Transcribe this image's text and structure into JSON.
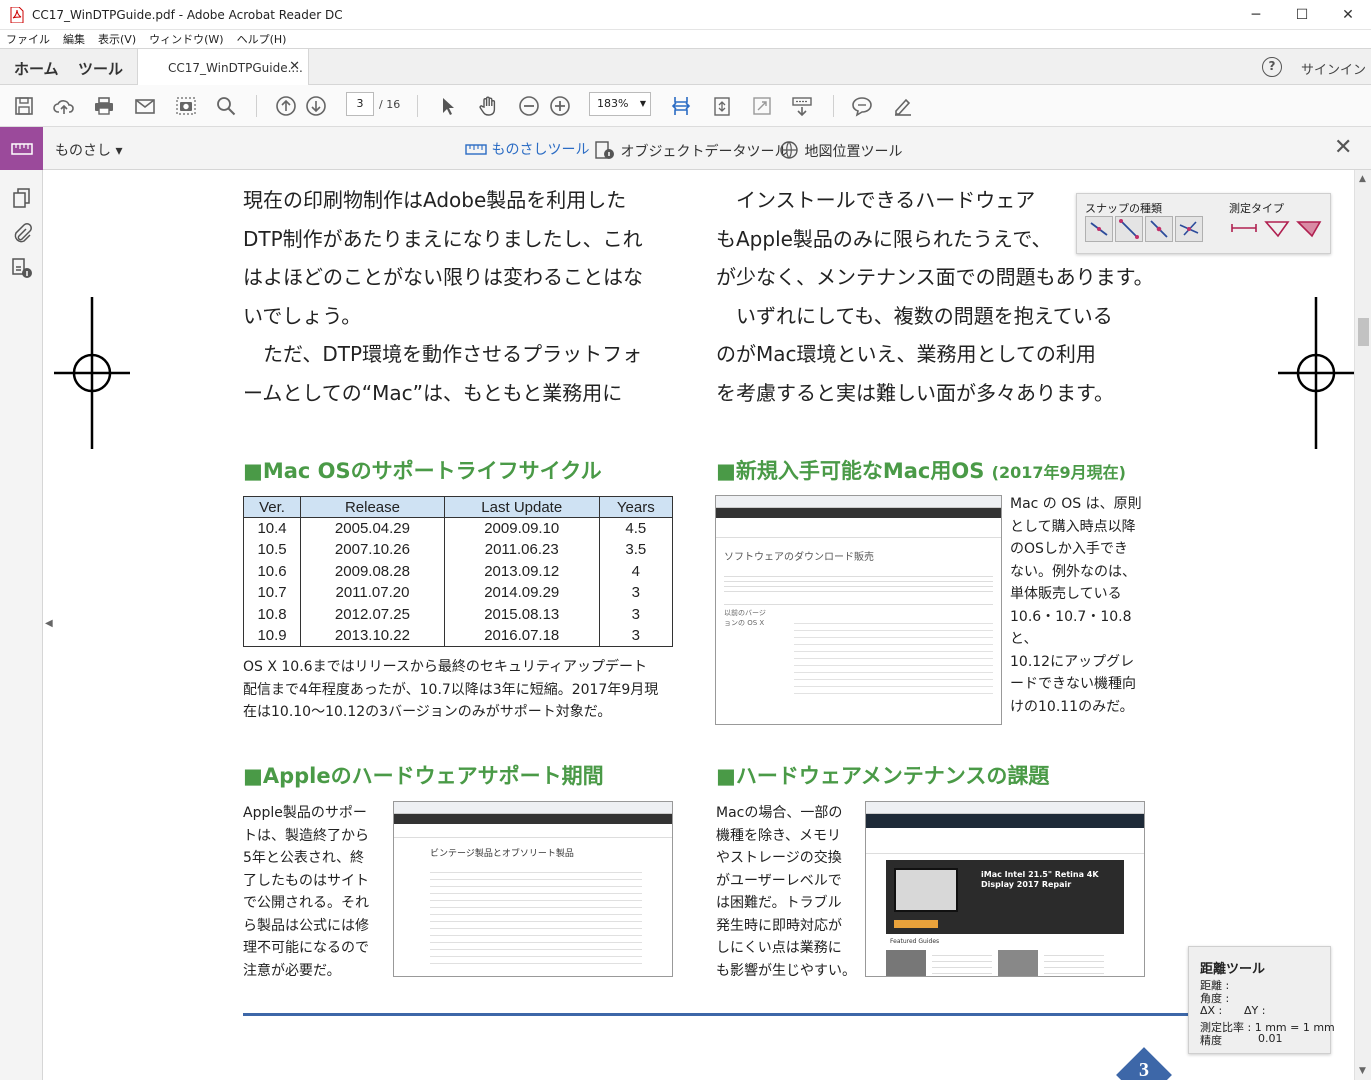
{
  "window": {
    "title": "CC17_WinDTPGuide.pdf - Adobe Acrobat Reader DC",
    "minimize": "─",
    "maximize": "☐",
    "close": "✕"
  },
  "menu": [
    "ファイル",
    "編集",
    "表示(V)",
    "ウィンドウ(W)",
    "ヘルプ(H)"
  ],
  "tabs": {
    "home": "ホーム",
    "tools": "ツール",
    "doc": "CC17_WinDTPGuide....",
    "help": "?",
    "signin": "サインイン"
  },
  "toolbar": {
    "page_current": "3",
    "page_total": "/ 16",
    "zoom": "183%"
  },
  "measure": {
    "label": "ものさし ▾",
    "tool_measure": "ものさしツール",
    "tool_object": "オブジェクトデータツール",
    "tool_geo": "地図位置ツール"
  },
  "snap_panel": {
    "snap_label": "スナップの種類",
    "type_label": "測定タイプ"
  },
  "distance_panel": {
    "title": "距離ツール",
    "distance": "距離 :",
    "angle": "角度 :",
    "dx": "ΔX :",
    "dy": "ΔY :",
    "scale": "測定比率 :  1 mm = 1 mm",
    "precision": "精度",
    "precision_value": "0.01"
  },
  "doc": {
    "left_intro": [
      "現在の印刷物制作はAdobe製品を利用した",
      "DTP制作があたりまえになりましたし、これ",
      "はよほどのことがない限りは変わることはな",
      "いでしょう。",
      "　ただ、DTP環境を動作させるプラットフォ",
      "ームとしての“Mac”は、もともと業務用に"
    ],
    "right_intro": [
      "　インストールできるハードウェア",
      "もApple製品のみに限られたうえで、",
      "が少なく、メンテナンス面での問題もあります。",
      "　いずれにしても、複数の問題を抱えている",
      "のがMac環境といえ、業務用としての利用",
      "を考慮すると実は難しい面が多々あります。"
    ],
    "h1": "■Mac OSのサポートライフサイクル",
    "h2": "■新規入手可能なMac用OS",
    "h2_sub": "(2017年9月現在)",
    "h3": "■Appleのハードウェアサポート期間",
    "h4": "■ハードウェアメンテナンスの課題",
    "table_headers": [
      "Ver.",
      "Release",
      "Last Update",
      "Years"
    ],
    "table_rows": [
      [
        "10.4",
        "2005.04.29",
        "2009.09.10",
        "4.5"
      ],
      [
        "10.5",
        "2007.10.26",
        "2011.06.23",
        "3.5"
      ],
      [
        "10.6",
        "2009.08.28",
        "2013.09.12",
        "4"
      ],
      [
        "10.7",
        "2011.07.20",
        "2014.09.29",
        "3"
      ],
      [
        "10.8",
        "2012.07.25",
        "2015.08.13",
        "3"
      ],
      [
        "10.9",
        "2013.10.22",
        "2016.07.18",
        "3"
      ]
    ],
    "table_note": [
      "OS X 10.6まではリリースから最終のセキュリティアップデート",
      "配信まで4年程度あったが、10.7以降は3年に短縮。2017年9月現",
      "在は10.10〜10.12の3バージョンのみがサポート対象だ。"
    ],
    "os_text": [
      "Mac の OS は、原則",
      "として購入時点以降",
      "のOSしか入手でき",
      "ない。例外なのは、",
      "単体販売している",
      "10.6・10.7・10.8と、",
      "10.12にアップグレ",
      "ードできない機種向",
      "けの10.11のみだ。"
    ],
    "apple_text": [
      "Apple製品のサポー",
      "トは、製造終了から",
      "5年と公表され、終",
      "了したものはサイト",
      "で公開される。それ",
      "ら製品は公式には修",
      "理不可能になるので",
      "注意が必要だ。"
    ],
    "maint_text": [
      "Macの場合、一部の",
      "機種を除き、メモリ",
      "やストレージの交換",
      "がユーザーレベルで",
      "は困難だ。トラブル",
      "発生時に即時対応が",
      "しにくい点は業務に",
      "も影響が生じやすい。"
    ],
    "shot1_heading": "ソフトウェアのダウンロード販売",
    "shot1_side": "以前のバージョンの OS X",
    "shot2_heading": "ビンテージ製品とオブソリート製品",
    "shot3_title": "iMac Intel 21.5\" Retina 4K Display 2017 Repair",
    "shot3_featured": "Featured Guides",
    "page_number": "3"
  }
}
